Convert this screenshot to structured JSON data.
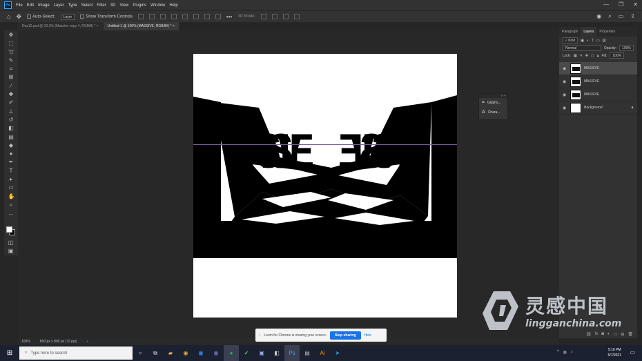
{
  "menu": {
    "app_icon": "Ps",
    "items": [
      "File",
      "Edit",
      "Image",
      "Layer",
      "Type",
      "Select",
      "Filter",
      "3D",
      "View",
      "Plugins",
      "Window",
      "Help"
    ],
    "window_controls": [
      "—",
      "❐",
      "✕"
    ]
  },
  "options": {
    "auto_select_label": "Auto-Select:",
    "auto_select_value": "Layer",
    "transform_label": "Show Transform Controls",
    "mode_label": "3D Mode:"
  },
  "tabs": [
    {
      "label": "Day12.psd @ 33.3% (Massive copy 4, RGB/8) *",
      "close": "×"
    },
    {
      "label": "Untitled-1 @ 100% (MASSIVE, RGB/8#) *",
      "close": "×"
    }
  ],
  "canvas": {
    "word": "MASSIVE"
  },
  "float_panel": {
    "items": [
      {
        "icon": "glyph-panel-icon",
        "label": "Glyphs..."
      },
      {
        "icon": "character-icon",
        "label": "Chara..."
      }
    ]
  },
  "right_panel": {
    "tabs": [
      "Paragraph",
      "Layers",
      "Properties"
    ],
    "filter_label": "Kind",
    "blend_mode": "Normal",
    "opacity_label": "Opacity:",
    "opacity_value": "100%",
    "lock_label": "Lock:",
    "fill_label": "Fill:",
    "fill_value": "100%",
    "layers": [
      {
        "name": "MASSIVE",
        "selected": true
      },
      {
        "name": "MASSIVE",
        "selected": false
      },
      {
        "name": "MASSIVE",
        "selected": false
      },
      {
        "name": "Background",
        "selected": false
      }
    ]
  },
  "status": {
    "zoom": "100%",
    "doc_size": "800 px x 800 px (72 ppi)"
  },
  "loom": {
    "message": "Loom for Chrome is sharing your screen.",
    "stop_label": "Stop sharing",
    "hide_label": "Hide"
  },
  "taskbar": {
    "search_placeholder": "Type here to search",
    "time": "5:16 PM",
    "date": "5/7/2021"
  },
  "watermark": {
    "cn": "灵感中国",
    "url": "lingganchina.com"
  },
  "colors": {
    "accent": "#31a8ff",
    "loom_button": "#1a73e8",
    "guide": "#7b5aa0"
  }
}
